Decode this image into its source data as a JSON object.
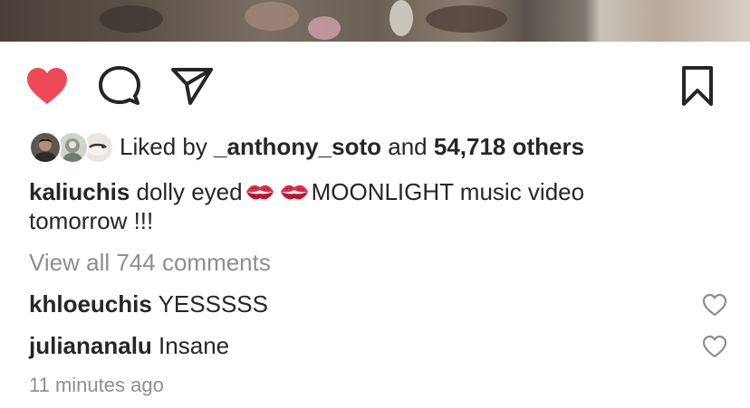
{
  "post": {
    "actions": {
      "like_icon": "heart-filled-icon",
      "comment_icon": "comment-bubble-icon",
      "share_icon": "paper-plane-icon",
      "save_icon": "bookmark-icon",
      "like_color": "#ed4956"
    },
    "likes": {
      "prefix": "Liked by",
      "user": "_anthony_soto",
      "conjunction": "and",
      "others": "54,718 others"
    },
    "caption": {
      "username": "kaliuchis",
      "text_before": "dolly eyed",
      "emoji": "kiss-mark",
      "text_after": "MOONLIGHT music video tomorrow !!!"
    },
    "view_all_comments": "View all 744 comments",
    "comments": [
      {
        "username": "khloeuchis",
        "text": "YESSSSS"
      },
      {
        "username": "juliananalu",
        "text": "Insane"
      }
    ],
    "timestamp": "11 minutes ago"
  }
}
